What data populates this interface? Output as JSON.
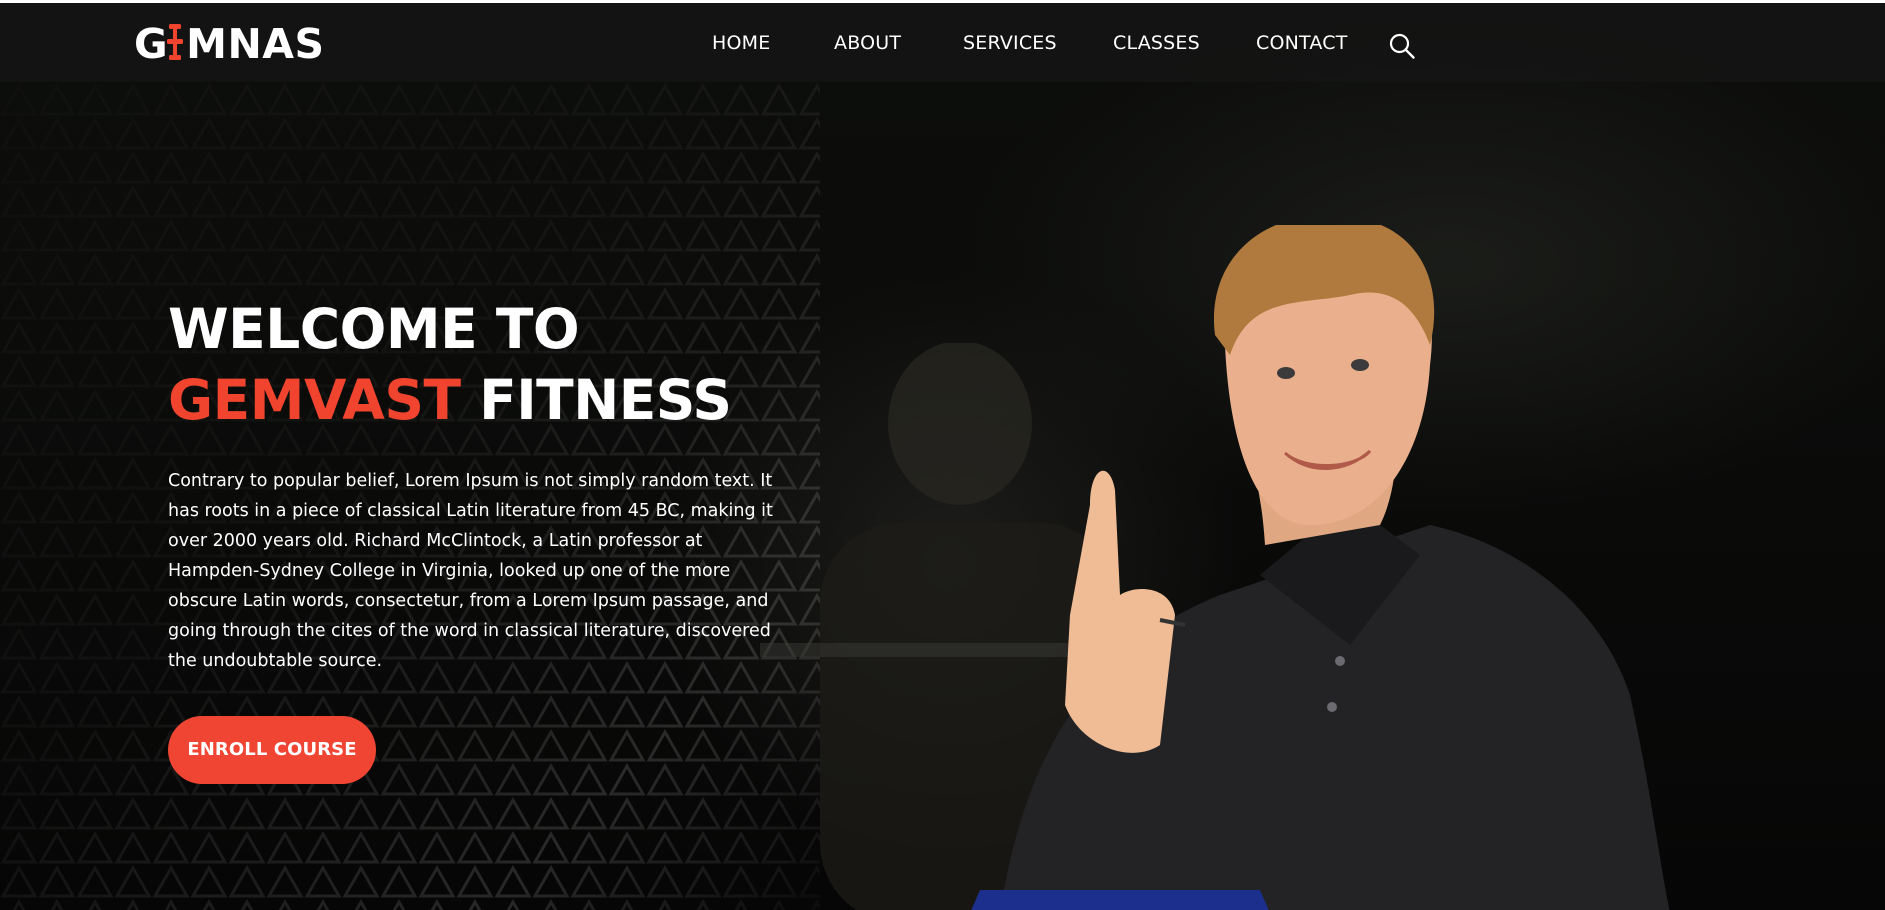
{
  "brand": {
    "logo_text": "GYMNAS",
    "logo_prefix": "G",
    "logo_suffix": "MNAS"
  },
  "nav": {
    "items": [
      {
        "label": "HOME"
      },
      {
        "label": "ABOUT"
      },
      {
        "label": "SERVICES"
      },
      {
        "label": "CLASSES"
      },
      {
        "label": "CONTACT"
      }
    ],
    "search_icon": "search-icon"
  },
  "hero": {
    "title_line1": "WELCOME TO",
    "title_accent": "GEMVAST",
    "title_rest": "FITNESS",
    "description": "Contrary to popular belief, Lorem Ipsum is not simply random text. It has roots in a piece of classical Latin literature from 45 BC, making it over 2000 years old. Richard McClintock, a Latin professor at Hampden-Sydney College in Virginia, looked up one of the more obscure Latin words, consectetur, from a Lorem Ipsum passage, and going through the cites of the word in classical literature, discovered the undoubtable source.",
    "cta_label": "ENROLL COURSE"
  },
  "colors": {
    "accent": "#f0442e",
    "background": "#0b0c0a",
    "text": "#ffffff"
  }
}
